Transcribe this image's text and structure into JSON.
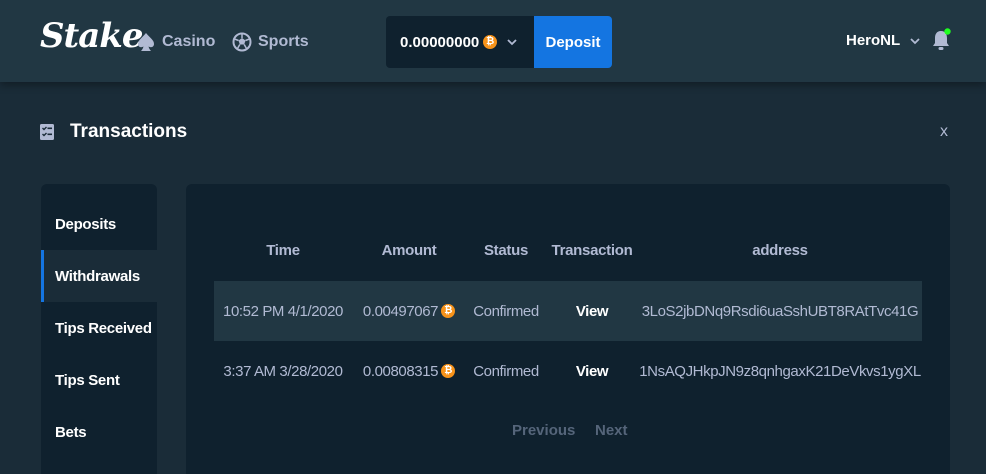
{
  "header": {
    "logo": "Stake",
    "nav": [
      {
        "label": "Casino",
        "icon": "spade-icon"
      },
      {
        "label": "Sports",
        "icon": "soccer-ball-icon"
      }
    ],
    "wallet": {
      "balance": "0.00000000",
      "currency_symbol": "₿"
    },
    "deposit_label": "Deposit",
    "username": "HeroNL",
    "notification_dot_color": "#1fff20"
  },
  "page": {
    "title": "Transactions",
    "close_label": "x"
  },
  "side_menu": {
    "items": [
      {
        "label": "Deposits"
      },
      {
        "label": "Withdrawals"
      },
      {
        "label": "Tips Received"
      },
      {
        "label": "Tips Sent"
      },
      {
        "label": "Bets"
      }
    ],
    "active": "Withdrawals"
  },
  "table": {
    "columns": [
      "Time",
      "Amount",
      "Status",
      "Transaction",
      "address"
    ],
    "rows": [
      {
        "time": "10:52 PM 4/1/2020",
        "amount": "0.00497067",
        "status": "Confirmed",
        "transaction": "View",
        "address": "3LoS2jbDNq9Rsdi6uaSshUBT8RAtTvc41G"
      },
      {
        "time": "3:37 AM 3/28/2020",
        "amount": "0.00808315",
        "status": "Confirmed",
        "transaction": "View",
        "address": "1NsAQJHkpJN9z8qnhgaxK21DeVkvs1ygXL"
      }
    ]
  },
  "pagination": {
    "previous": "Previous",
    "next": "Next"
  },
  "colors": {
    "background": "#1a2c38",
    "header": "#213743",
    "panel": "#0f212e",
    "accent": "#1475e1",
    "bitcoin": "#f7931a",
    "muted_text": "#b1bad3"
  }
}
